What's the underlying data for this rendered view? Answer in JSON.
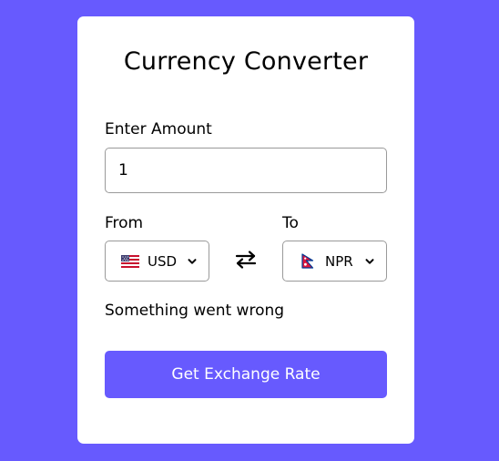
{
  "app": {
    "title": "Currency Converter",
    "background_color": "#675afe",
    "accent_color": "#675afe"
  },
  "amount": {
    "label": "Enter Amount",
    "value": "1"
  },
  "from": {
    "label": "From",
    "currency": "USD",
    "flag_icon": "us-flag-icon"
  },
  "to": {
    "label": "To",
    "currency": "NPR",
    "flag_icon": "nepal-flag-icon"
  },
  "swap": {
    "icon": "swap-arrows-icon"
  },
  "status": {
    "message": "Something went wrong"
  },
  "action": {
    "button_label": "Get Exchange Rate"
  }
}
